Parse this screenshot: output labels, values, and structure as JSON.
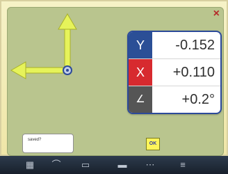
{
  "dialog": {
    "close_label": "×",
    "readout": {
      "rows": [
        {
          "tag": "Y",
          "value": "-0.152"
        },
        {
          "tag": "X",
          "value": "+0.110"
        },
        {
          "tag": "∠",
          "value": "+0.2°"
        }
      ]
    },
    "save_label": "saved?",
    "ok_label": "OK"
  },
  "taskbar": {
    "icons": [
      "document-icon",
      "curve-icon",
      "print-icon",
      "folder-icon",
      "grid-icon",
      "list-icon"
    ]
  }
}
